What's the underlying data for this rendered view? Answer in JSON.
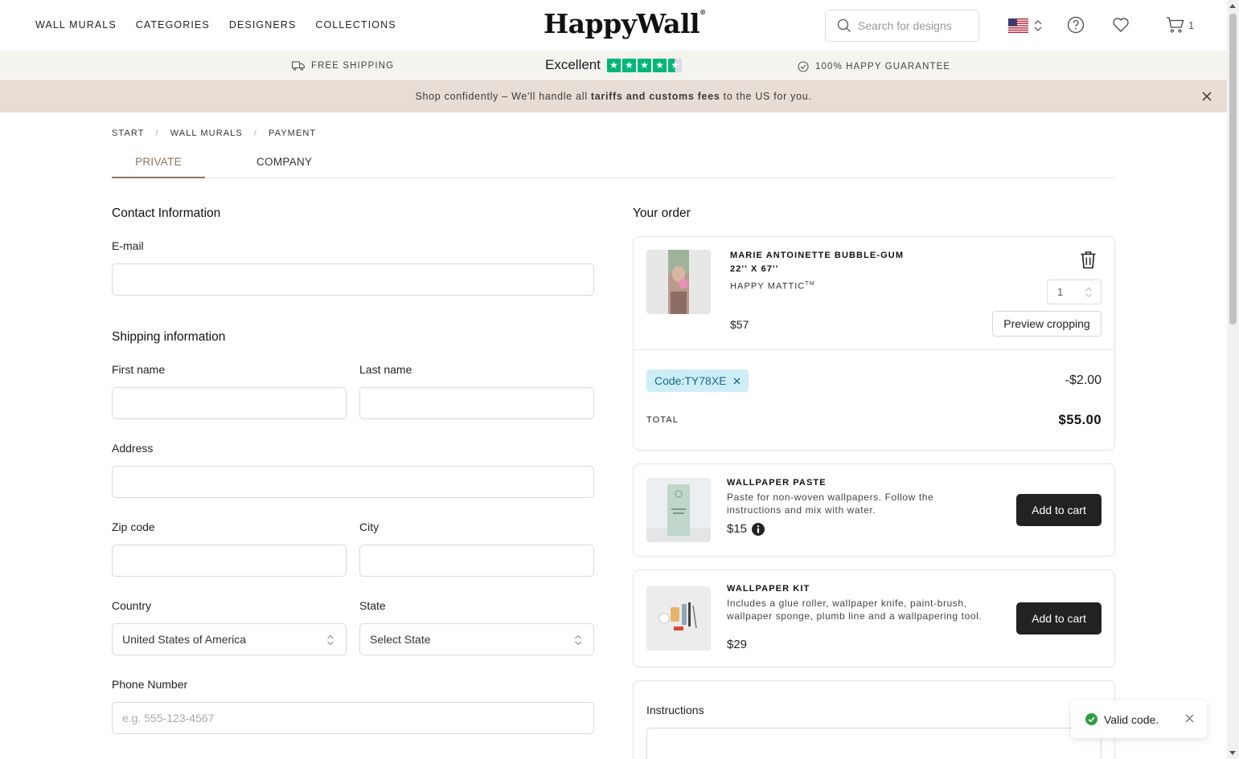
{
  "header": {
    "nav": [
      "WALL MURALS",
      "CATEGORIES",
      "DESIGNERS",
      "COLLECTIONS"
    ],
    "logo": "HappyWall",
    "search_placeholder": "Search for designs",
    "cart_count": "1"
  },
  "trust": {
    "shipping": "FREE SHIPPING",
    "rating_label": "Excellent",
    "rating_stars": 4.5,
    "guarantee": "100% HAPPY GUARANTEE"
  },
  "promo": {
    "text_before": "Shop confidently – We'll handle all ",
    "text_bold": "tariffs and customs fees",
    "text_after": " to the US for you."
  },
  "breadcrumb": [
    "START",
    "WALL MURALS",
    "PAYMENT"
  ],
  "tabs": {
    "private": "PRIVATE",
    "company": "COMPANY"
  },
  "form": {
    "contact_title": "Contact Information",
    "email_label": "E-mail",
    "shipping_title": "Shipping information",
    "first_name_label": "First name",
    "last_name_label": "Last name",
    "address_label": "Address",
    "zip_label": "Zip code",
    "city_label": "City",
    "country_label": "Country",
    "country_value": "United States of America",
    "state_label": "State",
    "state_value": "Select State",
    "phone_label": "Phone Number",
    "phone_placeholder": "e.g. 555-123-4567"
  },
  "order": {
    "title": "Your order",
    "item": {
      "name": "MARIE ANTOINETTE BUBBLE-GUM",
      "size": "22'' X 67''",
      "material": "HAPPY MATTIC",
      "material_tm": "TM",
      "price": "$57",
      "quantity": "1",
      "preview_label": "Preview cropping"
    },
    "code_label": "Code:TY78XE",
    "discount": "-$2.00",
    "total_label": "TOTAL",
    "total_value": "$55.00"
  },
  "addons": [
    {
      "name": "WALLPAPER PASTE",
      "desc": "Paste for non-woven wallpapers. Follow the instructions and mix with water.",
      "price": "$15",
      "button": "Add to cart"
    },
    {
      "name": "WALLPAPER KIT",
      "desc": "Includes a glue roller, wallpaper knife, paint-brush, wallpaper sponge, plumb line and a wallpapering tool.",
      "price": "$29",
      "button": "Add to cart"
    }
  ],
  "instructions_label": "Instructions",
  "toast": "Valid code.",
  "colors": {
    "accent": "#8a7660",
    "trustpilot": "#00b67a",
    "promo_bg": "#e8ddd4",
    "trust_bg": "#f5f3ee",
    "chip_bg": "#cdeef7",
    "button_dark": "#222222",
    "toast_check": "#2e9e3e"
  }
}
